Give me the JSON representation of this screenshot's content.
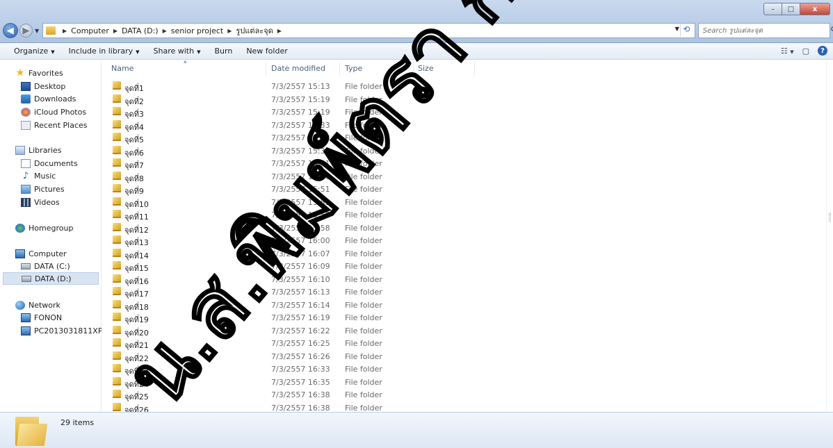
{
  "window": {
    "controls": {
      "minimize": "–",
      "maximize": "□",
      "close": "x"
    }
  },
  "address": {
    "crumbs": [
      "Computer",
      "DATA (D:)",
      "senior project",
      "รูปแต่ละจุด"
    ],
    "search_placeholder": "Search รูปแต่ละจุด"
  },
  "toolbar": {
    "organize": "Organize",
    "include_in_library": "Include in library",
    "share_with": "Share with",
    "burn": "Burn",
    "new_folder": "New folder"
  },
  "nav": {
    "favorites": "Favorites",
    "desktop": "Desktop",
    "downloads": "Downloads",
    "icloud": "iCloud Photos",
    "recent": "Recent Places",
    "libraries": "Libraries",
    "documents": "Documents",
    "music": "Music",
    "pictures": "Pictures",
    "videos": "Videos",
    "homegroup": "Homegroup",
    "computer": "Computer",
    "drive_c": "DATA (C:)",
    "drive_d": "DATA (D:)",
    "network": "Network",
    "fonon": "FONON",
    "pc": "PC2013031811XPA"
  },
  "columns": {
    "name": "Name",
    "date": "Date modified",
    "type": "Type",
    "size": "Size"
  },
  "files": [
    {
      "name": "จุดที่1",
      "date": "7/3/2557 15:13",
      "type": "File folder"
    },
    {
      "name": "จุดที่2",
      "date": "7/3/2557 15:19",
      "type": "File folder"
    },
    {
      "name": "จุดที่3",
      "date": "7/3/2557 15:19",
      "type": "File folder"
    },
    {
      "name": "จุดที่4",
      "date": "7/3/2557 15:33",
      "type": "File folder"
    },
    {
      "name": "จุดที่5",
      "date": "7/3/2557 15:33",
      "type": "File folder"
    },
    {
      "name": "จุดที่6",
      "date": "7/3/2557 15:39",
      "type": "File folder"
    },
    {
      "name": "จุดที่7",
      "date": "7/3/2557 15:41",
      "type": "File folder"
    },
    {
      "name": "จุดที่8",
      "date": "7/3/2557 15:46",
      "type": "File folder"
    },
    {
      "name": "จุดที่9",
      "date": "7/3/2557 15:51",
      "type": "File folder"
    },
    {
      "name": "จุดที่10",
      "date": "7/3/2557 15:53",
      "type": "File folder"
    },
    {
      "name": "จุดที่11",
      "date": "7/3/2557 15:55",
      "type": "File folder"
    },
    {
      "name": "จุดที่12",
      "date": "7/3/2557 15:58",
      "type": "File folder"
    },
    {
      "name": "จุดที่13",
      "date": "7/3/2557 16:00",
      "type": "File folder"
    },
    {
      "name": "จุดที่14",
      "date": "7/3/2557 16:07",
      "type": "File folder"
    },
    {
      "name": "จุดที่15",
      "date": "7/3/2557 16:09",
      "type": "File folder"
    },
    {
      "name": "จุดที่16",
      "date": "7/3/2557 16:10",
      "type": "File folder"
    },
    {
      "name": "จุดที่17",
      "date": "7/3/2557 16:13",
      "type": "File folder"
    },
    {
      "name": "จุดที่18",
      "date": "7/3/2557 16:14",
      "type": "File folder"
    },
    {
      "name": "จุดที่19",
      "date": "7/3/2557 16:19",
      "type": "File folder"
    },
    {
      "name": "จุดที่20",
      "date": "7/3/2557 16:22",
      "type": "File folder"
    },
    {
      "name": "จุดที่21",
      "date": "7/3/2557 16:25",
      "type": "File folder"
    },
    {
      "name": "จุดที่22",
      "date": "7/3/2557 16:26",
      "type": "File folder"
    },
    {
      "name": "จุดที่23",
      "date": "7/3/2557 16:33",
      "type": "File folder"
    },
    {
      "name": "จุดที่24",
      "date": "7/3/2557 16:35",
      "type": "File folder"
    },
    {
      "name": "จุดที่25",
      "date": "7/3/2557 16:38",
      "type": "File folder"
    },
    {
      "name": "จุดที่26",
      "date": "7/3/2557 16:38",
      "type": "File folder"
    }
  ],
  "status": {
    "count": "29 items"
  },
  "watermark_text": "น.ส.พิมพ์ตรา ก้อนไม้",
  "colors": {
    "accent": "#2b61b3",
    "folder": "#e4b23c"
  }
}
